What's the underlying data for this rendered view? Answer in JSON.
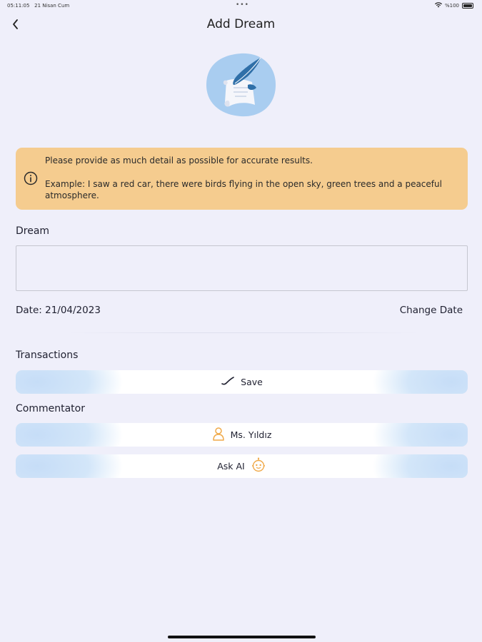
{
  "status_bar": {
    "time": "05:11:05",
    "date": "21 Nisan Cum",
    "battery": "%100"
  },
  "header": {
    "title": "Add Dream"
  },
  "notice": {
    "line1": "Please provide as much detail as possible for accurate results.",
    "line2": "Example: I saw a red car, there were birds flying in the open sky, green trees and a peaceful atmosphere."
  },
  "dream": {
    "label": "Dream",
    "value": "",
    "placeholder": ""
  },
  "date": {
    "text": "Date: 21/04/2023",
    "change_label": "Change Date"
  },
  "transactions": {
    "label": "Transactions",
    "save_label": "Save"
  },
  "commentator": {
    "label": "Commentator",
    "options": [
      {
        "label": "Ms. Yıldız",
        "icon": "person-icon"
      },
      {
        "label": "Ask AI",
        "icon": "ai-robot-icon"
      }
    ]
  },
  "colors": {
    "background": "#efeffa",
    "notice_bg": "#f5cc8f",
    "pill_accent": "#cfe2f9",
    "icon_orange": "#f0a948",
    "hero_blue": "#a9cdf0"
  }
}
